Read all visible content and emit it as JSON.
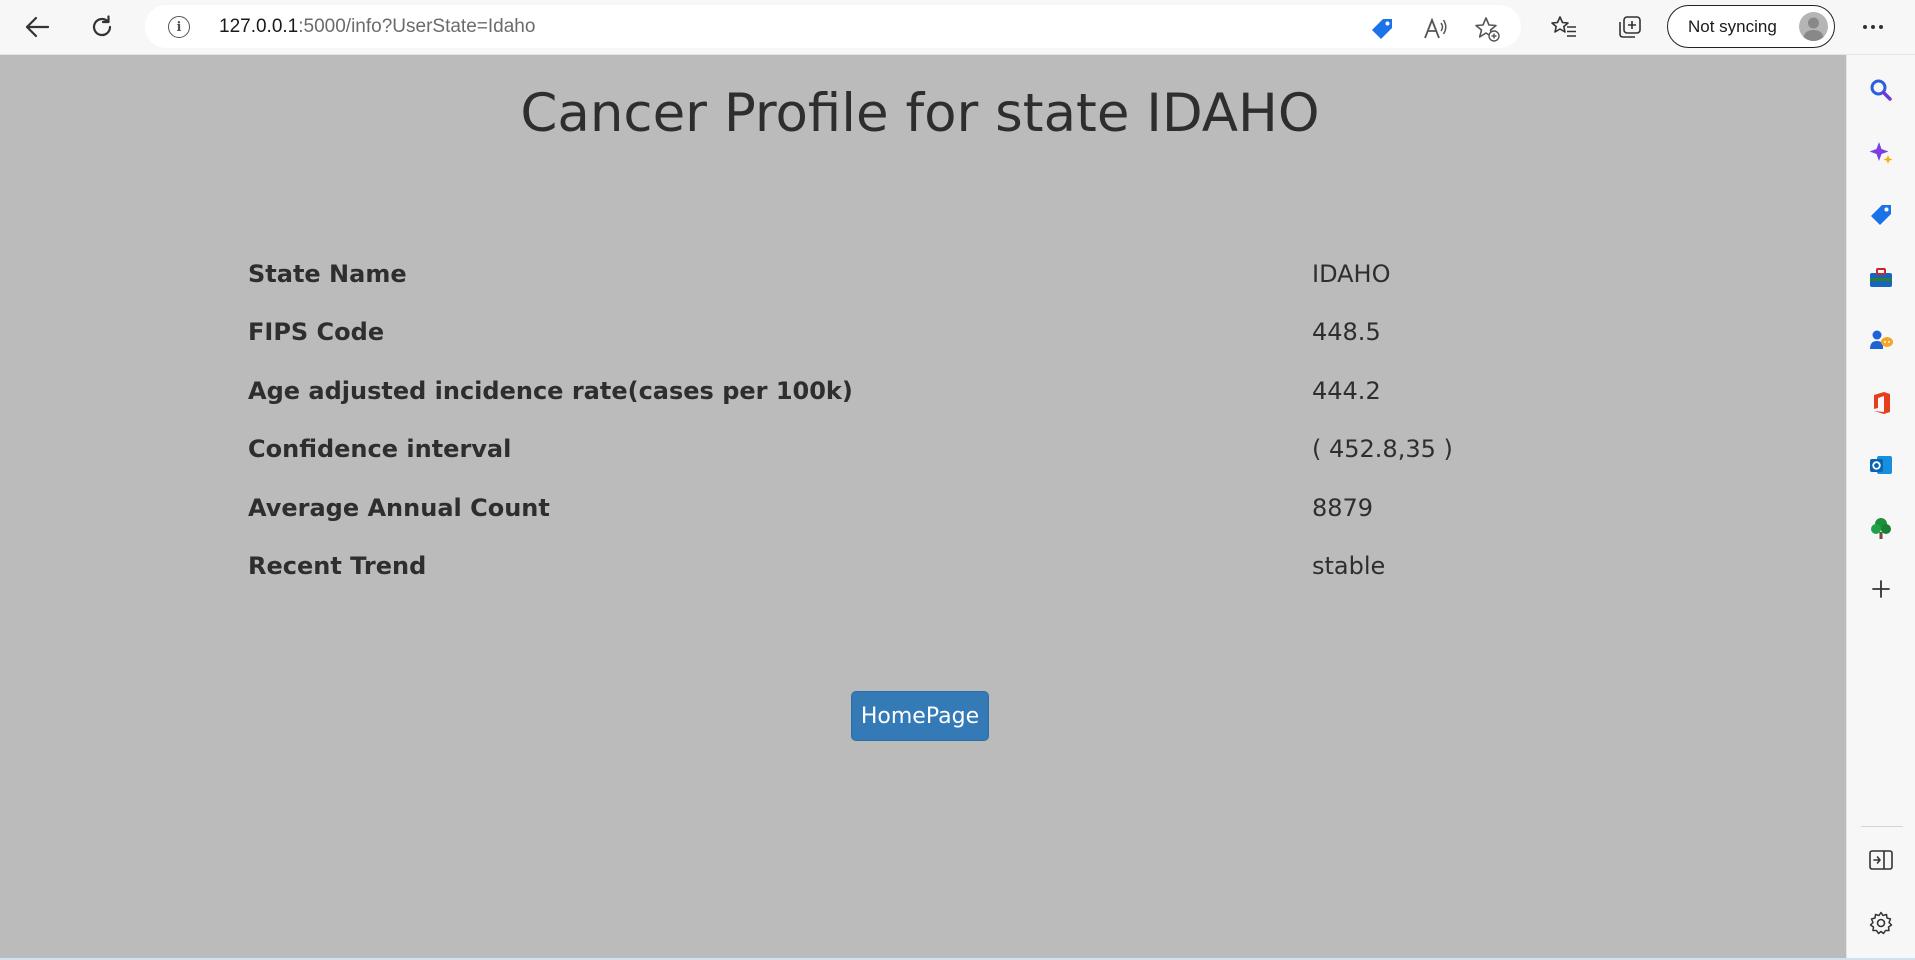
{
  "browser": {
    "url_host": "127.0.0.1",
    "url_rest": ":5000/info?UserState=Idaho",
    "sync_label": "Not syncing",
    "icons": {
      "back": "back-arrow-icon",
      "refresh": "refresh-icon",
      "info": "site-info-icon",
      "shopping": "shopping-tag-icon",
      "read_aloud": "read-aloud-icon",
      "add_favorite": "add-favorite-icon",
      "favorites": "favorites-icon",
      "collections": "collections-icon",
      "more": "more-options-icon"
    }
  },
  "page": {
    "title": "Cancer Profile for state IDAHO",
    "rows": [
      {
        "label": "State Name",
        "value": "IDAHO"
      },
      {
        "label": "FIPS Code",
        "value": "448.5"
      },
      {
        "label": "Age adjusted incidence rate(cases per 100k)",
        "value": "444.2"
      },
      {
        "label": "Confidence interval",
        "value": "( 452.8,35 )"
      },
      {
        "label": "Average Annual Count",
        "value": "8879"
      },
      {
        "label": "Recent Trend",
        "value": "stable"
      }
    ],
    "home_button": "HomePage"
  },
  "sidebar": {
    "icons": [
      "search-icon",
      "copilot-sparkle-icon",
      "shopping-tag-icon",
      "tools-icon",
      "games-icon",
      "office-icon",
      "outlook-icon",
      "drop-tree-icon",
      "add-icon",
      "split-screen-icon",
      "settings-icon"
    ]
  },
  "colors": {
    "content_bg": "#bbbbbb",
    "button_bg": "#337ab7",
    "text": "#2e2e2e"
  }
}
